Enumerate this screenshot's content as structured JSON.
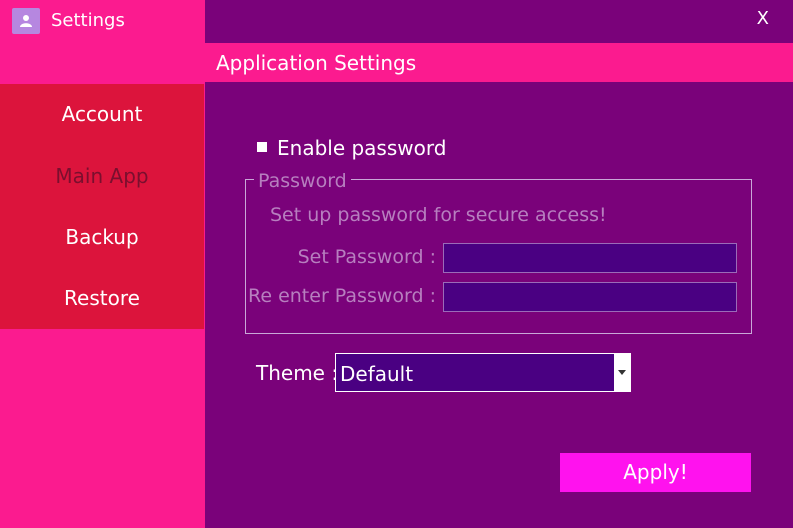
{
  "window": {
    "title": "Settings",
    "icon": "user-icon",
    "close_label": "X"
  },
  "header": {
    "title": "Application Settings"
  },
  "sidebar": {
    "items": [
      {
        "label": "Account"
      },
      {
        "label": "Main App"
      },
      {
        "label": "Backup"
      },
      {
        "label": "Restore"
      }
    ]
  },
  "security": {
    "enable_password_label": "Enable password",
    "enable_password_checked": false,
    "group_title": "Password",
    "description": "Set up password for secure access!",
    "set_password_label": "Set Password :",
    "set_password_value": "",
    "reenter_password_label": "Re enter Password :",
    "reenter_password_value": ""
  },
  "theme": {
    "label": "Theme :",
    "selected": "Default"
  },
  "actions": {
    "apply_label": "Apply!"
  },
  "colors": {
    "sidebar_bg": "#fb1b8f",
    "nav_bg": "#dc143c",
    "main_bg": "#7a027a",
    "input_bg": "#4a0082",
    "apply_bg": "#ff12ee"
  }
}
